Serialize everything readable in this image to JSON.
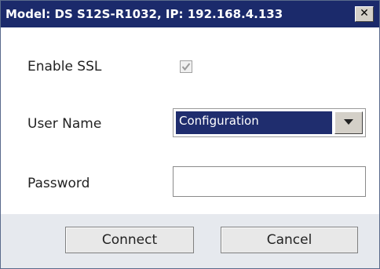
{
  "dialog": {
    "title": "Model: DS S12S-R1032, IP: 192.168.4.133",
    "close_label": "✕"
  },
  "form": {
    "enable_ssl_label": "Enable SSL",
    "enable_ssl_checked": true,
    "user_name_label": "User Name",
    "user_name_value": "Configuration",
    "password_label": "Password",
    "password_value": ""
  },
  "buttons": {
    "connect_label": "Connect",
    "cancel_label": "Cancel"
  },
  "colors": {
    "titlebar": "#1b2a6b",
    "selected_option_bg": "#1f2d6e",
    "footer_bg": "#e6e9ee"
  }
}
